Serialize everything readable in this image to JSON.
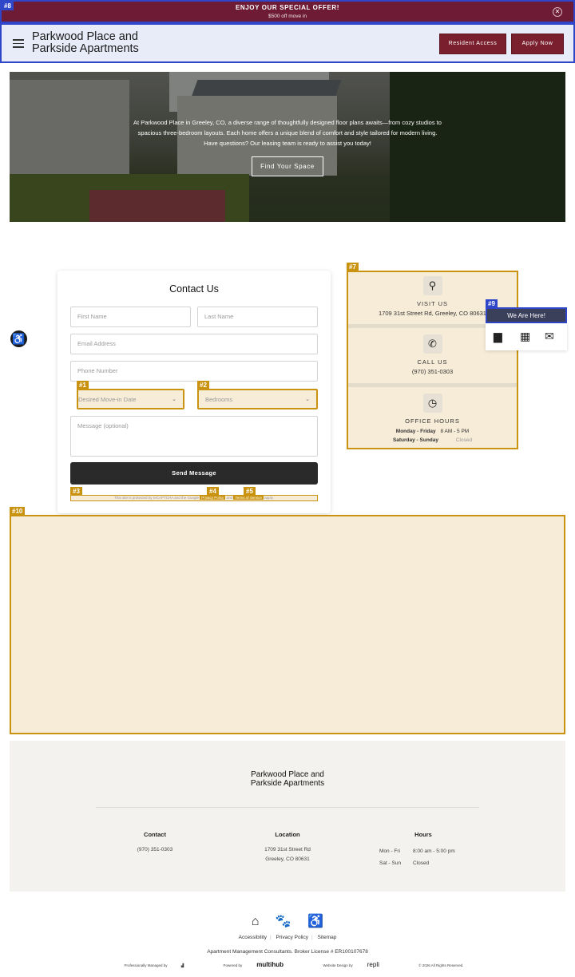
{
  "promo": {
    "title": "ENJOY OUR SPECIAL OFFER!",
    "subtitle": "$500 off move in",
    "close": "✕"
  },
  "header": {
    "brand_line1": "Parkwood Place and",
    "brand_line2": "Parkside Apartments",
    "resident_access": "Resident Access",
    "apply_now": "Apply Now"
  },
  "hero": {
    "text": "At Parkwood Place in Greeley, CO, a diverse range of thoughtfully designed floor plans awaits—from cozy studios to spacious three-bedroom layouts. Each home offers a unique blend of comfort and style tailored for modern living. Have questions? Our leasing team is ready to assist you today!",
    "cta": "Find Your Space"
  },
  "form": {
    "title": "Contact Us",
    "first_name": "First Name",
    "last_name": "Last Name",
    "email": "Email Address",
    "phone": "Phone Number",
    "move_in": "Desired Move-in Date",
    "bedrooms": "Bedrooms",
    "message": "Message (optional)",
    "submit": "Send Message",
    "recaptcha_pre": "This site is protected by reCAPTCHA and the Google",
    "privacy_link": "Privacy Policy",
    "and": "and",
    "terms_link": "Terms of Service",
    "apply": "apply."
  },
  "info": {
    "visit_label": "VISIT US",
    "visit_value": "1709 31st Street Rd, Greeley, CO 80631",
    "call_label": "CALL US",
    "call_value": "(970) 351-0303",
    "hours_label": "OFFICE HOURS",
    "hours": [
      {
        "days": "Monday - Friday",
        "time": "8 AM - 5 PM"
      },
      {
        "days": "Saturday - Sunday",
        "time": "Closed"
      }
    ]
  },
  "widget": {
    "label": "We Are Here!"
  },
  "footer": {
    "brand_line1": "Parkwood Place and",
    "brand_line2": "Parkside Apartments",
    "contact_h": "Contact",
    "contact_phone": "(970) 351-0303",
    "location_h": "Location",
    "location_l1": "1709 31st Street Rd",
    "location_l2": "Greeley, CO 80631",
    "hours_h": "Hours",
    "hours": [
      {
        "days": "Mon - Fri",
        "time": "8:00 am - 5:00 pm"
      },
      {
        "days": "Sat - Sun",
        "time": "Closed"
      }
    ],
    "links": [
      "Accessibility",
      "Privacy Policy",
      "Sitemap"
    ],
    "license": "Apartment Management Consultants. Broker License # ER100107678",
    "managed_by": "Professionally Managed by",
    "powered_by": "Powered by",
    "multihub": "multihub",
    "design_by": "Website Design by",
    "repli": "repli",
    "copyright": "© 2026 All Rights Reserved."
  },
  "colors": {
    "promo": "#6e1b36",
    "button": "#7a1f2e",
    "highlight": "#c9920f"
  }
}
